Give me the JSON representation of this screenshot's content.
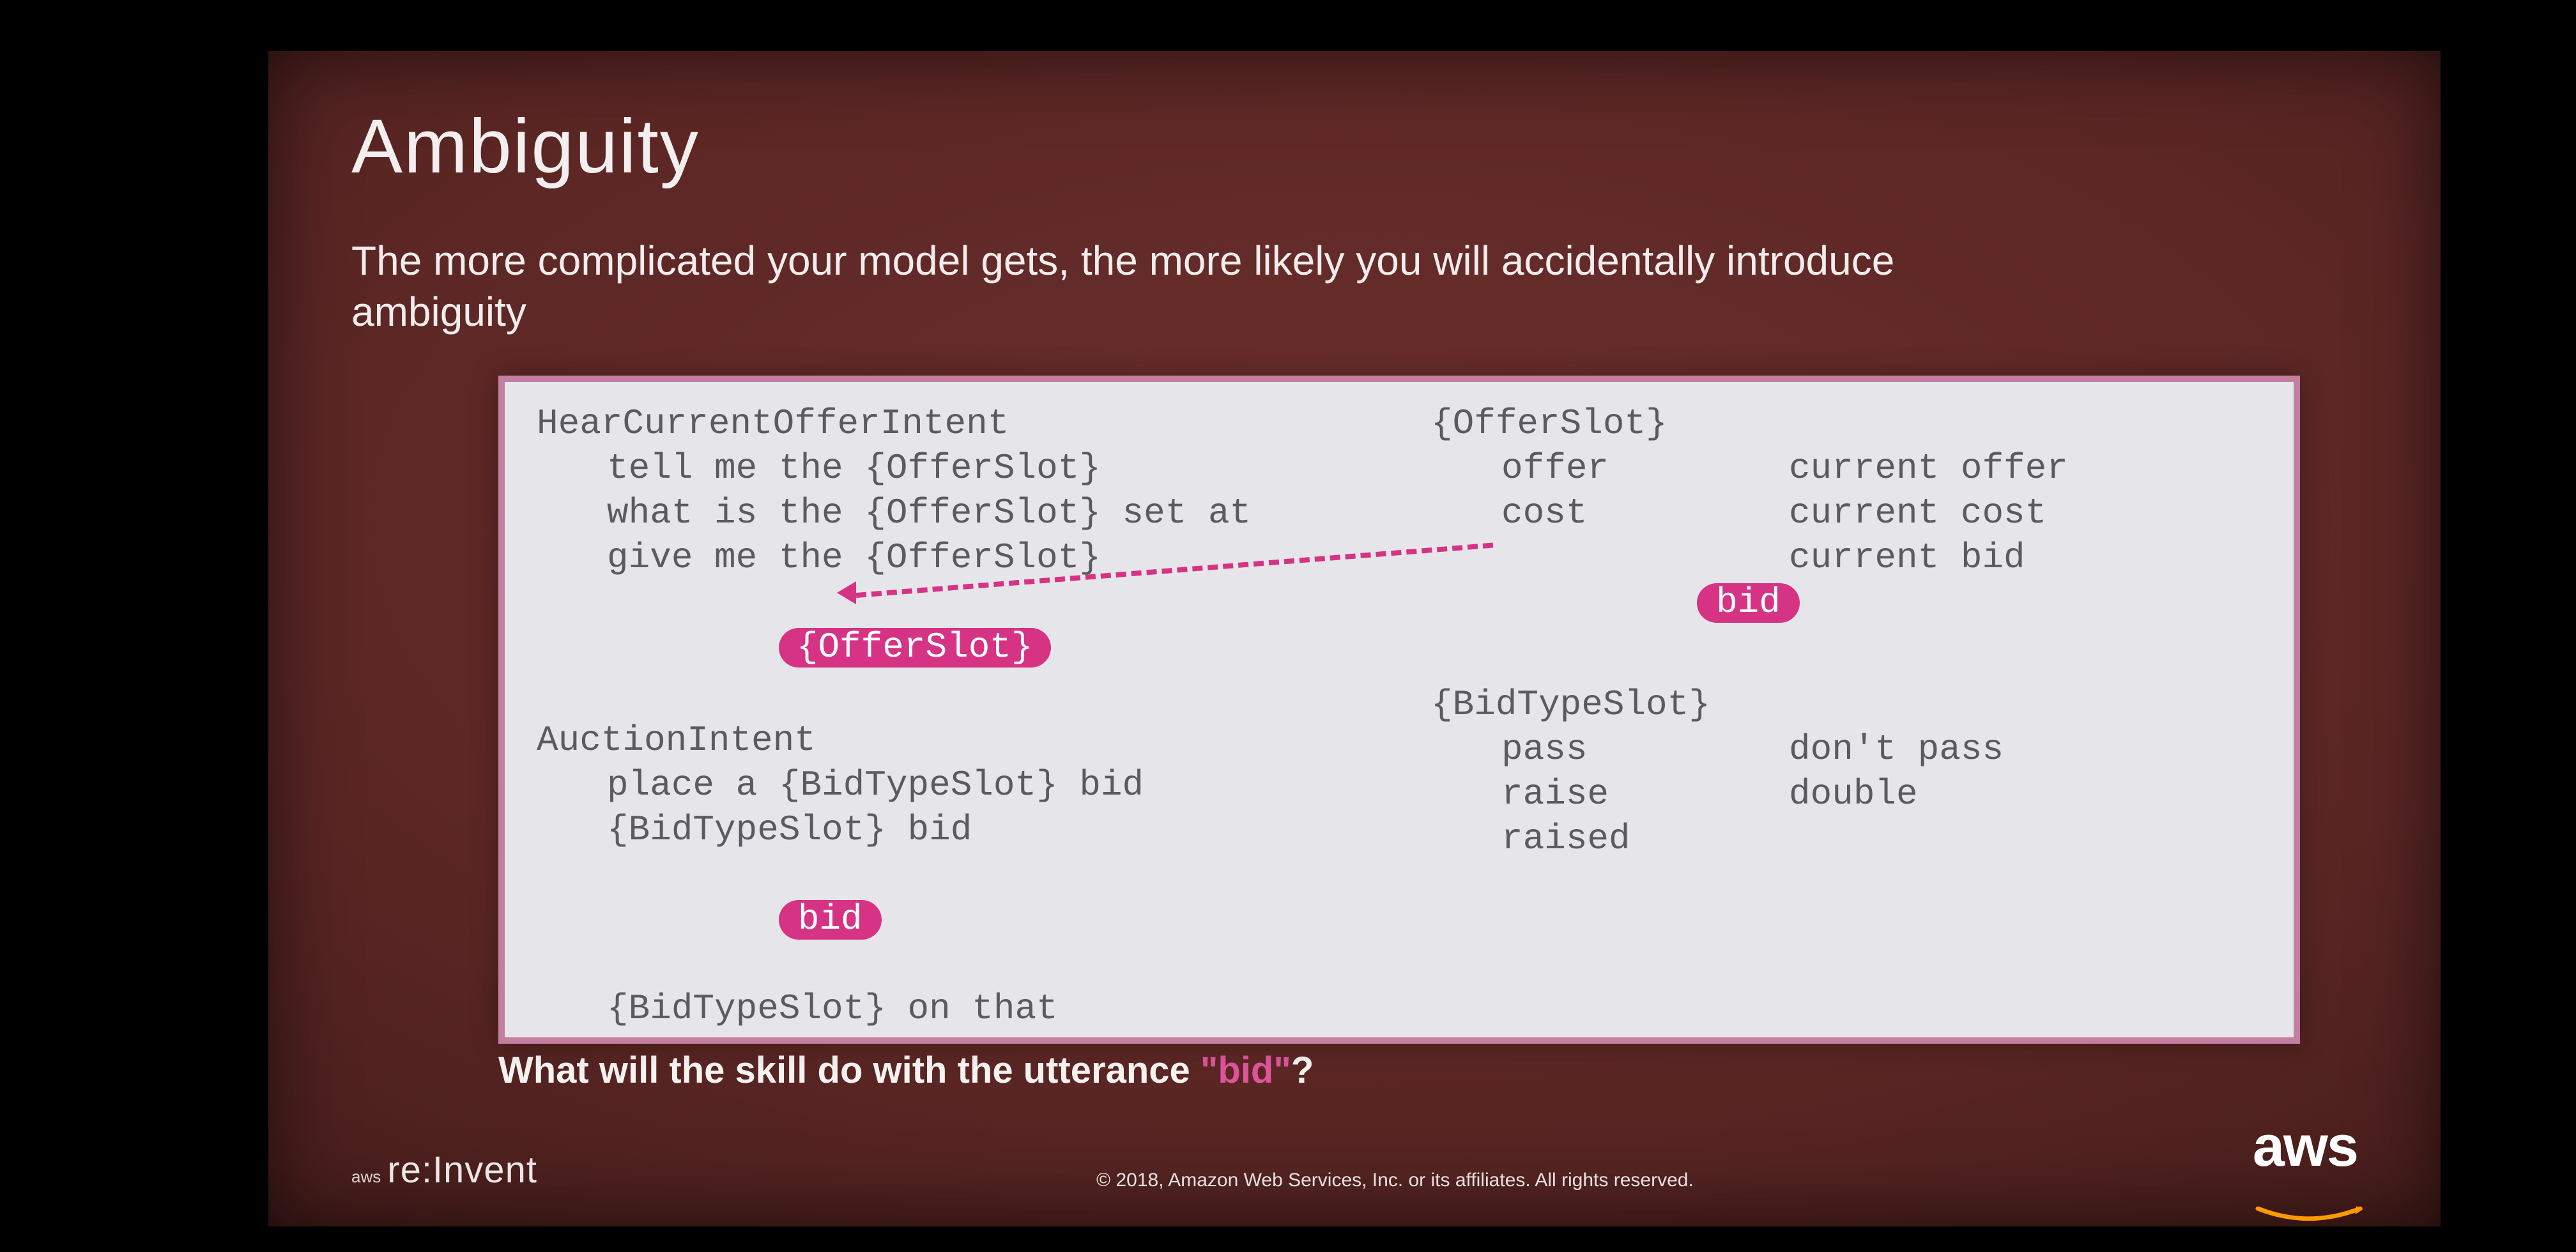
{
  "title": "Ambiguity",
  "subtitle": "The more complicated your model gets, the more likely you will accidentally introduce ambiguity",
  "intent1": {
    "name": "HearCurrentOfferIntent",
    "u1": "tell me the {OfferSlot}",
    "u2": "what is the {OfferSlot} set at",
    "u3": "give me the {OfferSlot}",
    "u4_highlight": "{OfferSlot}"
  },
  "intent2": {
    "name": "AuctionIntent",
    "u1": "place a {BidTypeSlot} bid",
    "u2": "{BidTypeSlot} bid",
    "u3_highlight": "bid",
    "u4": "{BidTypeSlot} on that"
  },
  "slot1": {
    "header": "{OfferSlot}",
    "r1a": "offer",
    "r1b": "current offer",
    "r2a": "cost",
    "r2b": "current cost",
    "r3a_highlight": "bid",
    "r3b": "current bid"
  },
  "slot2": {
    "header": "{BidTypeSlot}",
    "r1a": "pass",
    "r1b": "don't pass",
    "r2a": "raise",
    "r2b": "double",
    "r3a": "raised"
  },
  "question_pre": "What will the skill do with the utterance ",
  "question_hl": "\"bid\"",
  "question_post": "?",
  "footer": {
    "reinvent_prefix": "aws",
    "reinvent": "re:Invent",
    "copyright": "© 2018, Amazon Web Services, Inc. or its affiliates. All rights reserved.",
    "aws": "aws"
  }
}
